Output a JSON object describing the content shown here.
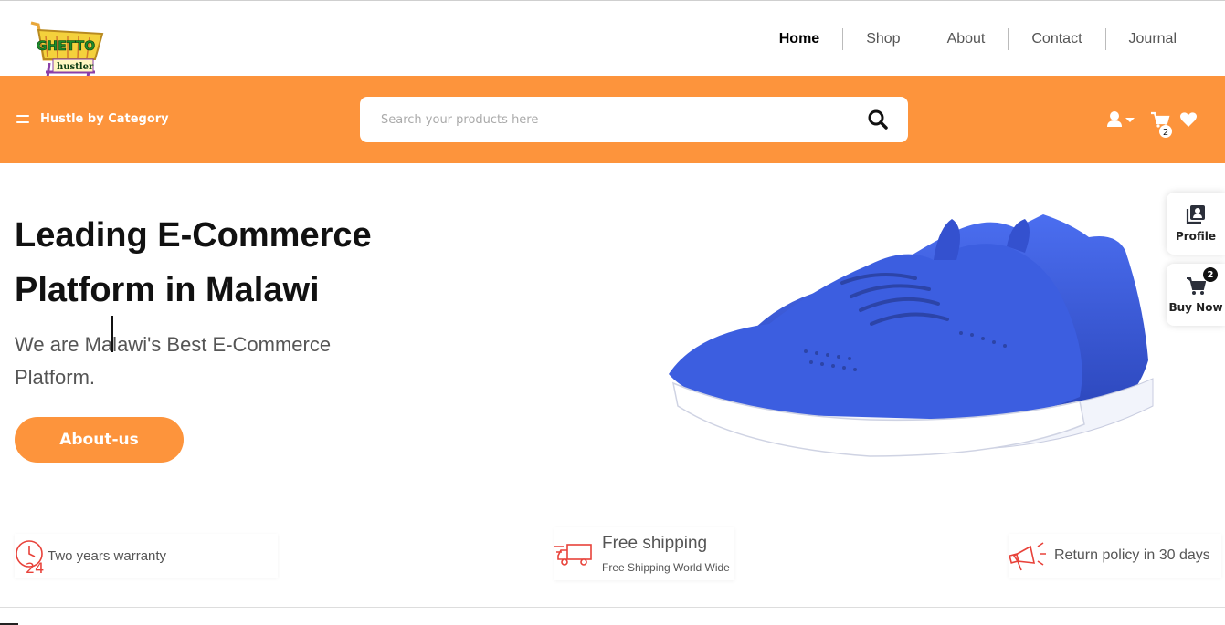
{
  "header": {
    "logo": {
      "line1": "GHETTO",
      "line2": "hustler"
    },
    "nav": [
      {
        "label": "Home",
        "active": true
      },
      {
        "label": "Shop",
        "active": false
      },
      {
        "label": "About",
        "active": false
      },
      {
        "label": "Contact",
        "active": false
      },
      {
        "label": "Journal",
        "active": false
      }
    ]
  },
  "bar": {
    "category_label": "Hustle by Category",
    "search": {
      "placeholder": "Search your products here",
      "value": ""
    },
    "cart_count": "2",
    "icons": [
      "user-icon",
      "caret-down-icon",
      "cart-icon",
      "heart-icon"
    ]
  },
  "hero": {
    "title": "Leading E-Commerce Platform in Malawi",
    "subtitle": "We are Malawi's Best E-Commerce Platform.",
    "button_label": "About-us"
  },
  "side": {
    "profile_label": "Profile",
    "buy_label": "Buy Now",
    "buy_count": "2"
  },
  "features": {
    "warranty": "Two years warranty",
    "shipping_title": "Free shipping",
    "shipping_sub": "Free Shipping World Wide",
    "returns": "Return policy in 30 days"
  },
  "colors": {
    "accent": "#fd943c",
    "icon_red": "#e8423a",
    "shoe_blue": "#3a5bd9"
  }
}
